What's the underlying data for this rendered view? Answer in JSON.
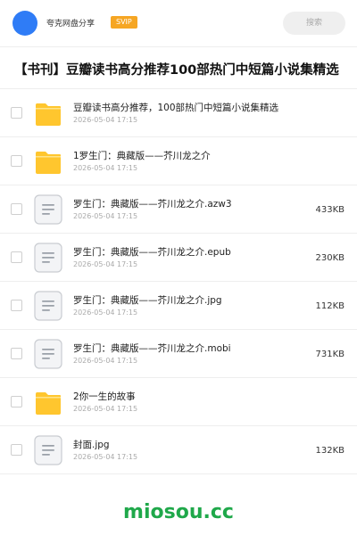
{
  "header": {
    "app_name": "夸克网盘分享",
    "badge": "SVIP",
    "search_label": "搜索",
    "avatar_color": "#2f7cf6",
    "badge_color": "#f6a623"
  },
  "page": {
    "title": "【书刊】豆瓣读书高分推荐100部热门中短篇小说集精选"
  },
  "files": [
    {
      "type": "folder",
      "icon": "folder-icon",
      "name": "豆瓣读书高分推荐，100部热门中短篇小说集精选",
      "date": "2026-05-04 17:15",
      "size": ""
    },
    {
      "type": "folder",
      "icon": "folder-icon",
      "name": "1罗生门：典藏版——芥川龙之介",
      "date": "2026-05-04 17:15",
      "size": ""
    },
    {
      "type": "file",
      "icon": "document-icon",
      "name": "罗生门：典藏版——芥川龙之介.azw3",
      "date": "2026-05-04 17:15",
      "size": "433KB"
    },
    {
      "type": "file",
      "icon": "document-icon",
      "name": "罗生门：典藏版——芥川龙之介.epub",
      "date": "2026-05-04 17:15",
      "size": "230KB"
    },
    {
      "type": "file",
      "icon": "document-icon",
      "name": "罗生门：典藏版——芥川龙之介.jpg",
      "date": "2026-05-04 17:15",
      "size": "112KB"
    },
    {
      "type": "file",
      "icon": "document-icon",
      "name": "罗生门：典藏版——芥川龙之介.mobi",
      "date": "2026-05-04 17:15",
      "size": "731KB"
    },
    {
      "type": "folder",
      "icon": "folder-icon",
      "name": "2你一生的故事",
      "date": "2026-05-04 17:15",
      "size": ""
    },
    {
      "type": "file",
      "icon": "document-icon",
      "name": "封面.jpg",
      "date": "2026-05-04 17:15",
      "size": "132KB"
    }
  ],
  "footer": {
    "watermark": "miosou.cc",
    "watermark_color": "#1fa84a"
  }
}
